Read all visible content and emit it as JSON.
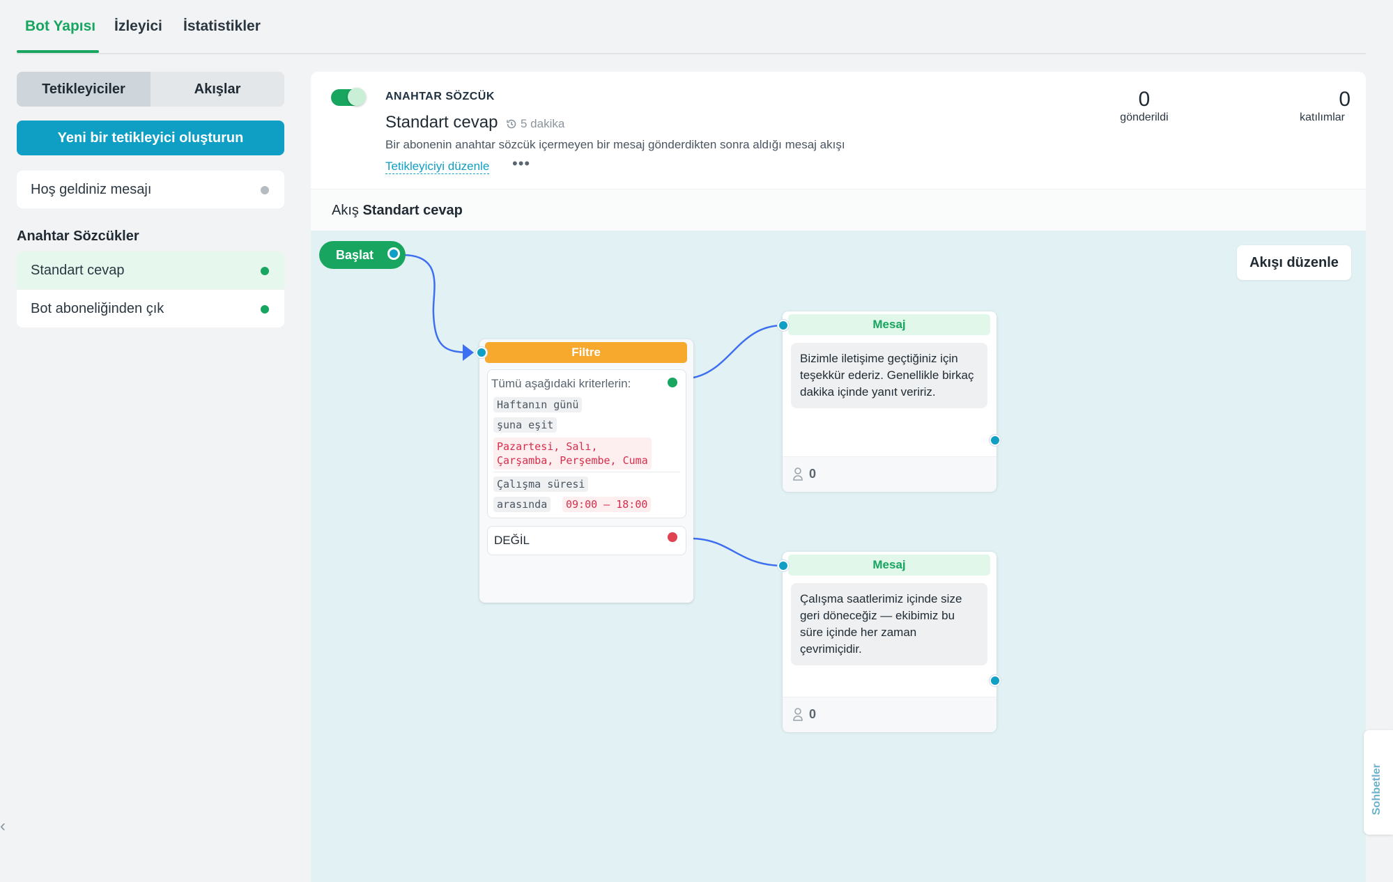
{
  "tabs": [
    "Bot Yapısı",
    "İzleyici",
    "İstatistikler"
  ],
  "sidebar": {
    "segments": [
      "Tetikleyiciler",
      "Akışlar"
    ],
    "new_trigger": "Yeni bir tetikleyici oluşturun",
    "welcome": "Hoş geldiniz mesajı",
    "keywords_heading": "Anahtar Sözcükler",
    "keywords": [
      "Standart cevap",
      "Bot aboneliğinden çık"
    ]
  },
  "header": {
    "label": "ANAHTAR SÖZCÜK",
    "title": "Standart cevap",
    "time": "5 dakika",
    "description": "Bir abonenin anahtar sözcük içermeyen bir mesaj gönderdikten sonra aldığı mesaj akışı",
    "edit_link": "Tetikleyiciyi düzenle",
    "more": "•••",
    "stats": [
      {
        "value": "0",
        "label": "gönderildi"
      },
      {
        "value": "0",
        "label": "katılımlar"
      }
    ]
  },
  "flow": {
    "prefix": "Akış",
    "name": "Standart cevap",
    "edit_button": "Akışı düzenle",
    "start": "Başlat"
  },
  "filter": {
    "title": "Filtre",
    "criteria_title": "Tümü aşağıdaki kriterlerin:",
    "c1_field": "Haftanın günü",
    "c1_op": "şuna eşit",
    "c1_value_line1": "Pazartesi, Salı,",
    "c1_value_line2": "Çarşamba, Perşembe, Cuma",
    "c2_field": "Çalışma süresi",
    "c2_op": "arasında",
    "c2_value": "09:00 — 18:00",
    "not_label": "DEĞİL"
  },
  "messages": [
    {
      "title": "Mesaj",
      "text": "Bizimle iletişime geçtiğiniz için teşekkür ederiz. Genellikle birkaç dakika içinde yanıt veririz.",
      "count": "0"
    },
    {
      "title": "Mesaj",
      "text": "Çalışma saatlerimiz içinde size geri döneceğiz — ekibimiz bu süre içinde her zaman çevrimiçidir.",
      "count": "0"
    }
  ],
  "chats_tab": "Sohbetler",
  "colors": {
    "accent_green": "#17a55f",
    "accent_blue": "#0f9ec4",
    "filter_orange": "#f7a92d",
    "status_red": "#e0424f",
    "status_gray": "#b5bcc1"
  }
}
